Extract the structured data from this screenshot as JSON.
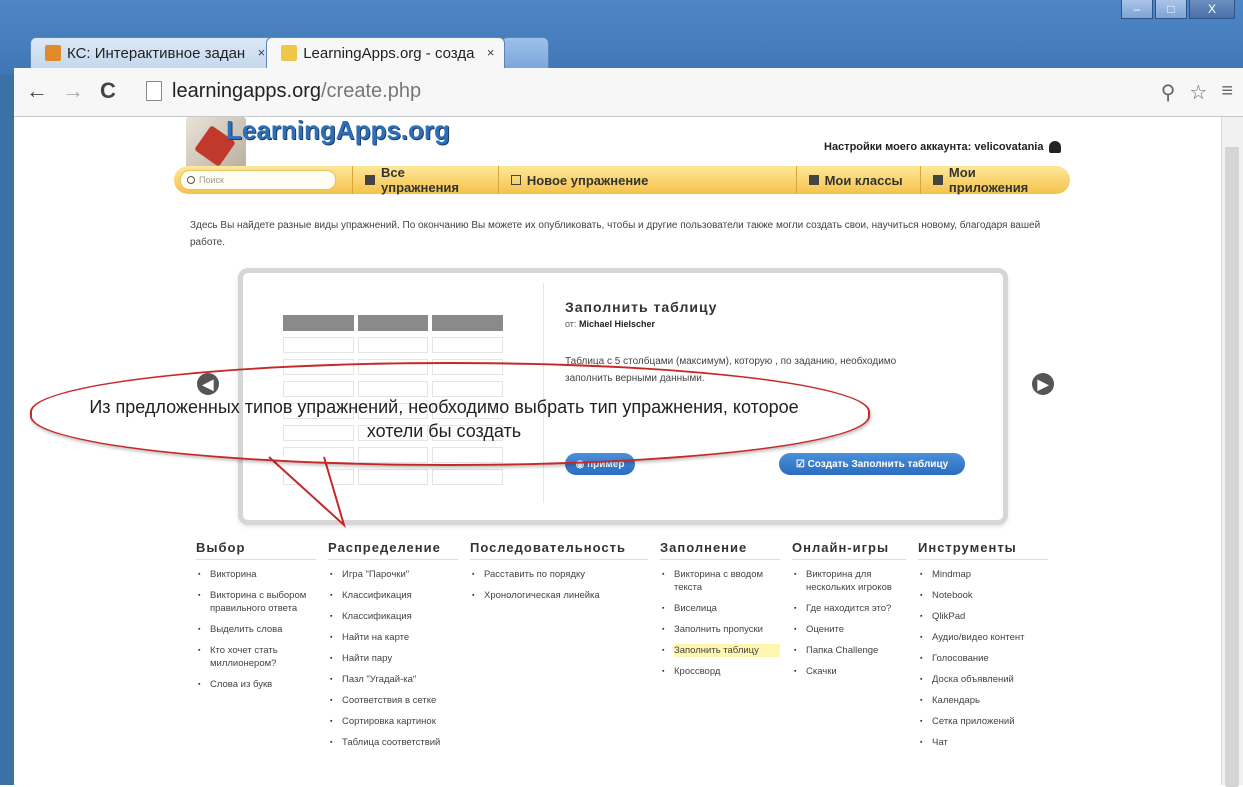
{
  "browser": {
    "tabs": [
      {
        "label": "КС: Интерактивное задан",
        "icon": "moodle-favicon-icon",
        "active": false
      },
      {
        "label": "LearningApps.org - созда",
        "icon": "learningapps-favicon-icon",
        "active": true
      }
    ],
    "url_host": "learningapps.org",
    "url_path": "/create.php",
    "window_controls": [
      "minimize",
      "maximize",
      "close"
    ],
    "symbols": {
      "back": "←",
      "forward": "→",
      "reload": "C",
      "tab_close": "×",
      "minimize": "–",
      "maximize": "□",
      "close": "X",
      "zoom": "⚲",
      "star": "☆",
      "menu": "≡"
    }
  },
  "site": {
    "logo": "LearningApps.org",
    "account_label": "Настройки моего аккаунта: velicovatania",
    "search_placeholder": "Поиск",
    "nav": [
      {
        "label": "Все упражнения"
      },
      {
        "label": "Новое упражнение"
      },
      {
        "label": "Мои классы"
      },
      {
        "label": "Мои приложения"
      }
    ],
    "intro": "Здесь Вы найдете разные виды упражнений. По окончанию Вы можете их опубликовать, чтобы и другие пользователи также могли создать свои, научиться новому, благодаря вашей работе."
  },
  "card": {
    "title": "Заполнить таблицу",
    "author_prefix": "от:",
    "author": "Michael Hielscher",
    "description": "Таблица с 5 столбцами (максимум), которую , по заданию, необходимо заполнить верными данными.",
    "example_button": "◉ пример",
    "create_button": "☑ Создать Заполнить таблицу",
    "prev_arrow": "◀",
    "next_arrow": "▶"
  },
  "callout": {
    "text": "Из предложенных типов упражнений, необходимо выбрать  тип упражнения, которое хотели бы создать"
  },
  "categories": [
    {
      "title": "Выбор",
      "items": [
        "Викторина",
        "Викторина с выбором правильного ответа",
        "Выделить слова",
        "Кто хочет стать миллионером?",
        "Слова из букв"
      ]
    },
    {
      "title": "Распределение",
      "items": [
        "Игра \"Парочки\"",
        "Классификация",
        "Классификация",
        "Найти на карте",
        "Найти пару",
        "Пазл \"Угадай-ка\"",
        "Соответствия в сетке",
        "Сортировка картинок",
        "Таблица соответствий"
      ]
    },
    {
      "title": "Последовательность",
      "items": [
        "Расставить по порядку",
        "Хронологическая линейка"
      ]
    },
    {
      "title": "Заполнение",
      "items": [
        "Викторина с вводом текста",
        "Виселица",
        "Заполнить пропуски",
        "Заполнить таблицу",
        "Кроссворд"
      ],
      "highlight": 3
    },
    {
      "title": "Онлайн-игры",
      "items": [
        "Викторина для нескольких игроков",
        "Где находится это?",
        "Оцените",
        "Папка Challenge",
        "Скачки"
      ]
    },
    {
      "title": "Инструменты",
      "items": [
        "Mindmap",
        "Notebook",
        "QlikPad",
        "Аудио/видео контент",
        "Голосование",
        "Доска объявлений",
        "Календарь",
        "Сетка приложений",
        "Чат"
      ]
    }
  ],
  "colors": {
    "accent": "#2f6fb8",
    "nav": "#f6c24a",
    "callout": "#c62828",
    "highlight": "#fff7b0"
  }
}
